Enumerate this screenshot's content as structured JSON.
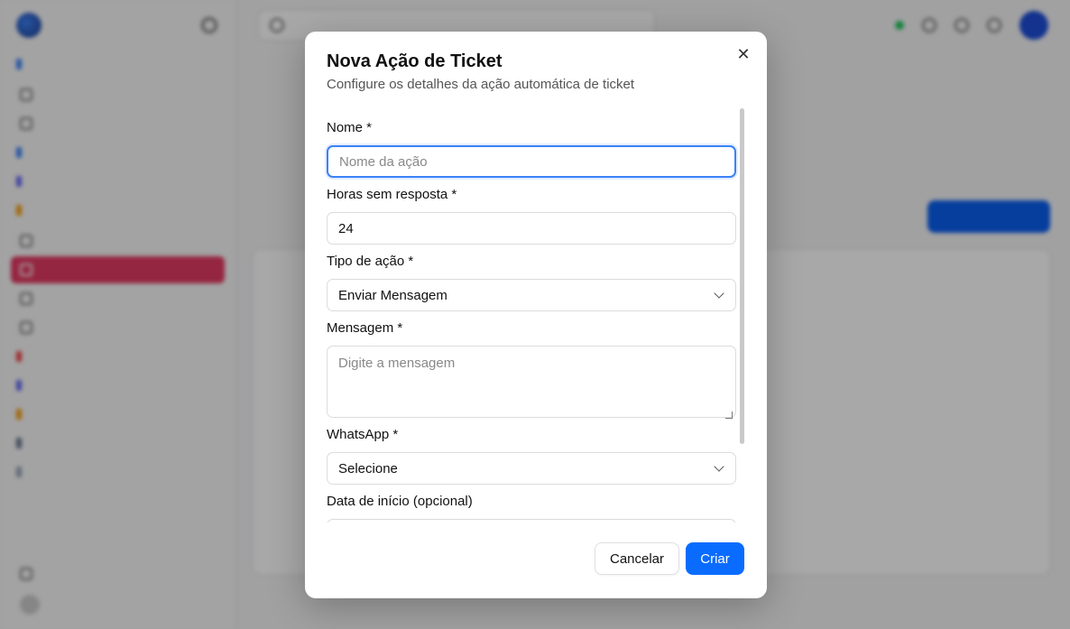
{
  "modal": {
    "title": "Nova Ação de Ticket",
    "subtitle": "Configure os detalhes da ação automática de ticket",
    "close_icon": "close-icon",
    "fields": {
      "name": {
        "label": "Nome *",
        "value": "",
        "placeholder": "Nome da ação"
      },
      "hours": {
        "label": "Horas sem resposta *",
        "value": "24"
      },
      "action_type": {
        "label": "Tipo de ação *",
        "selected": "Enviar Mensagem"
      },
      "message": {
        "label": "Mensagem *",
        "value": "",
        "placeholder": "Digite a mensagem"
      },
      "whatsapp": {
        "label": "WhatsApp *",
        "selected": "Selecione"
      },
      "start_date": {
        "label": "Data de início (opcional)"
      }
    },
    "buttons": {
      "cancel": "Cancelar",
      "create": "Criar"
    }
  },
  "colors": {
    "primary": "#0a6cff",
    "active_sidebar": "#e33a63",
    "focus_ring": "#3b82f6"
  }
}
